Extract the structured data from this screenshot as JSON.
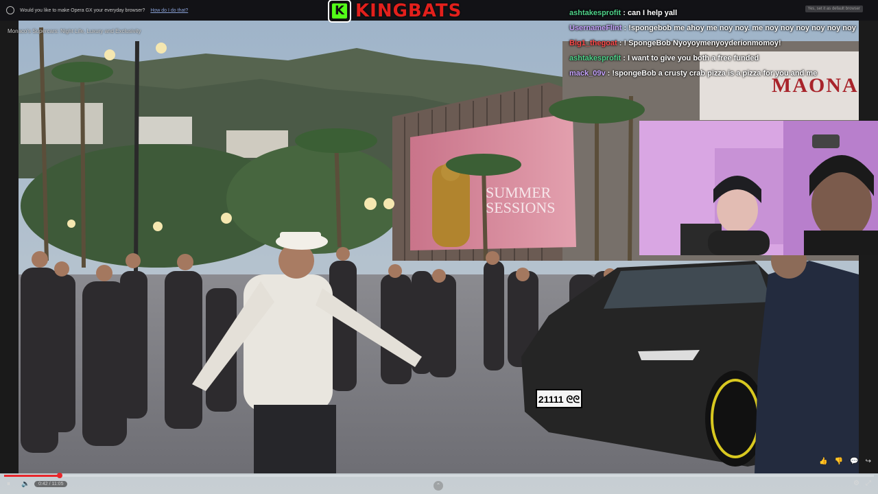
{
  "browser": {
    "prompt": "Would you like to make Opera GX your everyday browser?",
    "how_link": "How do I do that?",
    "set_default": "Yes, set it as default browser"
  },
  "stream": {
    "platform_logo": "K",
    "channel_name": "KINGBATS"
  },
  "video": {
    "title": "Monaco's Supercars: Night Life, Luxury and Exclusivity",
    "billboard_text": "SUMMER SESSIONS",
    "restaurant_sign": "MAONA",
    "license_plate": "21111 ᘓᘓ",
    "time_display": "0:42 / 11:05",
    "progress_fraction": 0.064
  },
  "chat": [
    {
      "user": "ashtakesprofit",
      "text": "can I help yall",
      "color": "#4fd38a"
    },
    {
      "user": "UsernameFlint",
      "text": "!spongebob me ahoy me noy noy. me noy noy noy noy noy noy",
      "color": "#c7a4ff"
    },
    {
      "user": "Big1_thegoat",
      "text": "! SpongeBob Nyoyoymenyoyderionmomoy!",
      "color": "#ff4b4b"
    },
    {
      "user": "ashtakesprofit",
      "text": "I want to give you both a free funded",
      "color": "#4fd38a"
    },
    {
      "user": "mack_09v",
      "text": "!spongeBob a crusty crab pizza is a pizza for you and me",
      "color": "#c7a4ff"
    }
  ],
  "icons": {
    "pause": "⏸",
    "volume": "🔈",
    "up": "⌃",
    "like": "👍",
    "dislike": "👎",
    "comment": "💬",
    "share": "↪",
    "settings": "⚙",
    "fullscreen": "⤢"
  }
}
